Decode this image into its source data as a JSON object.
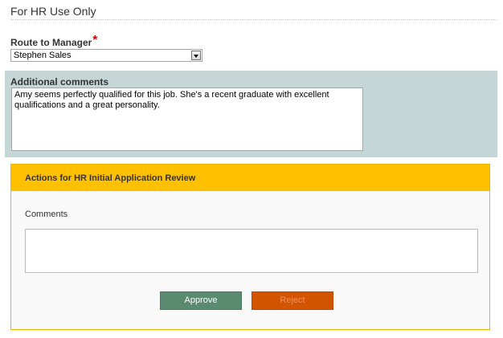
{
  "section": {
    "title": "For HR Use Only"
  },
  "route": {
    "label": "Route to Manager",
    "required_mark": "*",
    "selected": "Stephen Sales"
  },
  "additional_comments": {
    "label": "Additional comments",
    "text": "Amy seems perfectly qualified for this job. She's a recent graduate with excellent qualifications and a great personality."
  },
  "actions": {
    "title": "Actions for HR Initial Application Review",
    "comments_label": "Comments",
    "comments_value": "",
    "approve_label": "Approve",
    "reject_label": "Reject"
  },
  "colors": {
    "comments_panel_bg": "#c5d6d6",
    "actions_header_bg": "#ffc000",
    "approve_bg": "#5a8a70",
    "reject_bg": "#d35400",
    "required": "#cc0000"
  }
}
